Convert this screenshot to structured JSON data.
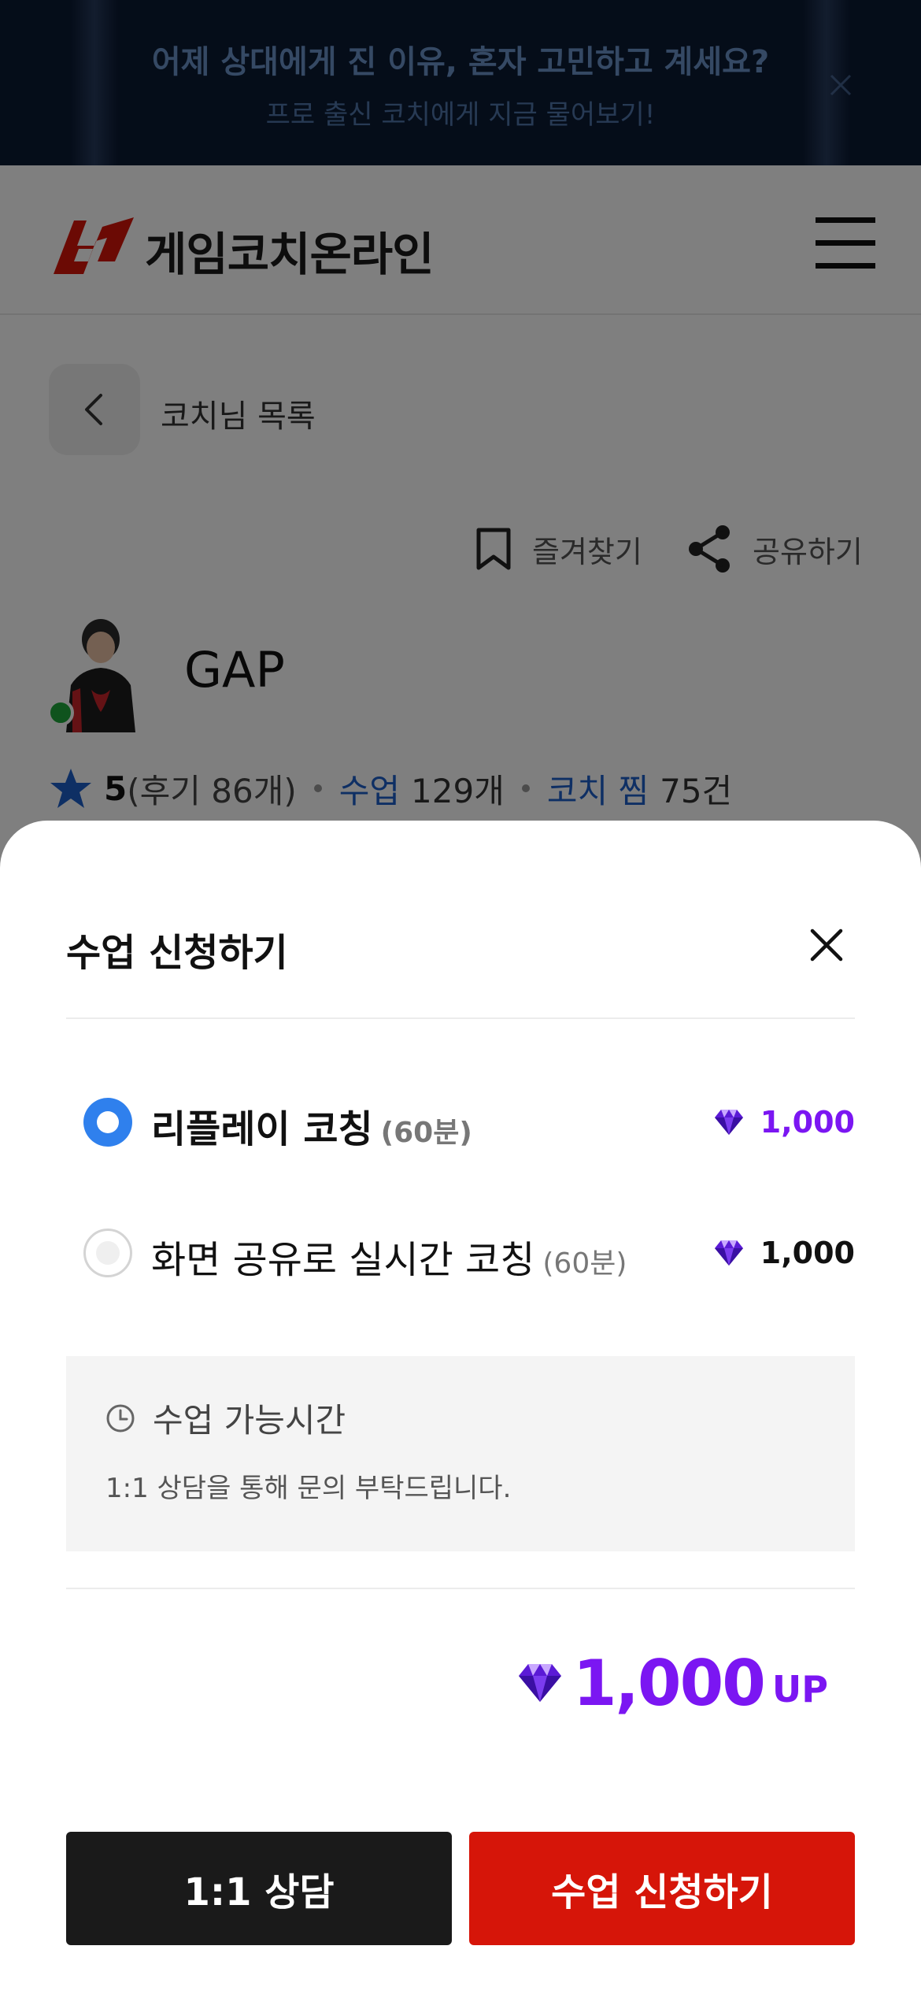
{
  "banner": {
    "title": "어제 상대에게 진 이유, 혼자 고민하고 계세요?",
    "subtitle": "프로 출신 코치에게 지금 물어보기!"
  },
  "header": {
    "logo_text": "게임코치온라인",
    "brand_color": "#d61509"
  },
  "nav": {
    "back_label": "코치님 목록"
  },
  "actions": {
    "favorite_label": "즐겨찾기",
    "share_label": "공유하기"
  },
  "coach": {
    "name": "GAP",
    "online": true,
    "rating": "5",
    "reviews": "(후기 86개)",
    "lessons_label": "수업",
    "lessons_value": "129개",
    "likes_label": "코치 찜",
    "likes_value": "75건"
  },
  "sheet": {
    "title": "수업 신청하기",
    "options": [
      {
        "label": "리플레이 코칭",
        "duration": "(60분)",
        "price": "1,000",
        "selected": true
      },
      {
        "label": "화면 공유로 실시간 코칭",
        "duration": "(60분)",
        "price": "1,000",
        "selected": false
      }
    ],
    "availability_title": "수업 가능시간",
    "availability_text": "1:1 상담을 통해 문의 부탁드립니다.",
    "total_value": "1,000",
    "total_unit": "UP",
    "consult_button": "1:1 상담",
    "apply_button": "수업 신청하기"
  },
  "colors": {
    "accent_purple": "#7b16f2",
    "radio_blue": "#2f80ed",
    "apply_red": "#d61509",
    "link_blue": "#1d5ec9",
    "online_green": "#1ea73a"
  }
}
